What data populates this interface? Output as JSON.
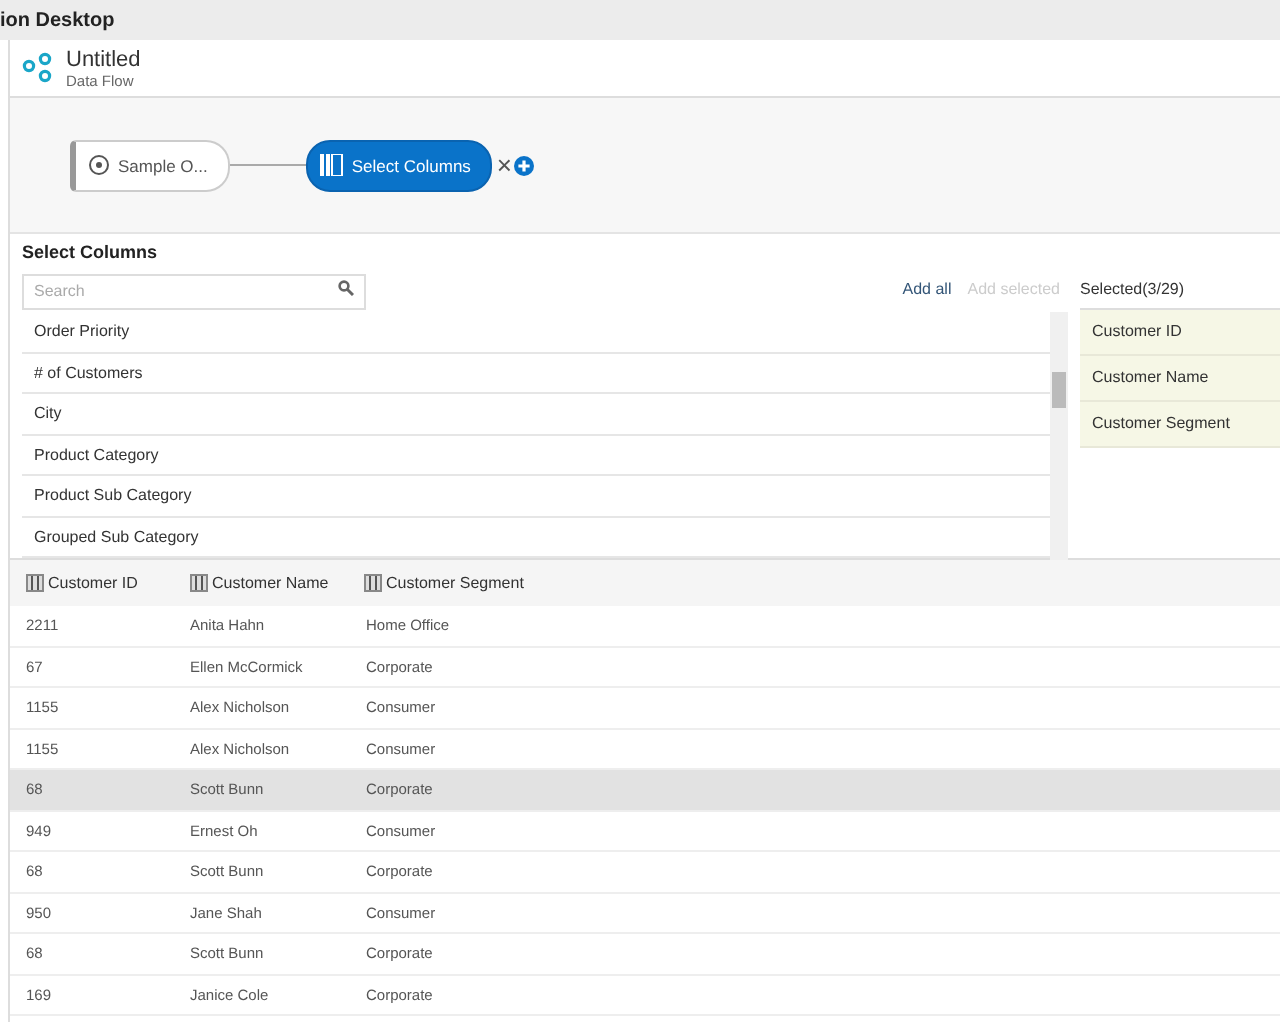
{
  "window": {
    "title": "ion Desktop"
  },
  "header": {
    "title": "Untitled",
    "subtitle": "Data Flow"
  },
  "flow": {
    "nodes": [
      {
        "kind": "source",
        "label": "Sample O...",
        "selected": false
      },
      {
        "kind": "step",
        "label": "Select Columns",
        "selected": true
      }
    ],
    "remove": "×"
  },
  "panel": {
    "title": "Select Columns",
    "search": {
      "placeholder": "Search"
    },
    "add_all": "Add all",
    "add_selected": {
      "label": "Add selected",
      "disabled": true
    },
    "selected_title": "Selected(3/29)",
    "available": [
      "Order Priority",
      "# of Customers",
      "City",
      "Product Category",
      "Product Sub Category",
      "Grouped Sub Category"
    ],
    "selected": [
      "Customer ID",
      "Customer Name",
      "Customer Segment"
    ]
  },
  "table": {
    "columns": [
      "Customer ID",
      "Customer Name",
      "Customer Segment"
    ],
    "rows": [
      {
        "cells": [
          "2211",
          "Anita Hahn",
          "Home Office"
        ],
        "selected": false
      },
      {
        "cells": [
          "67",
          "Ellen McCormick",
          "Corporate"
        ],
        "selected": false
      },
      {
        "cells": [
          "1155",
          "Alex Nicholson",
          "Consumer"
        ],
        "selected": false
      },
      {
        "cells": [
          "1155",
          "Alex Nicholson",
          "Consumer"
        ],
        "selected": false
      },
      {
        "cells": [
          "68",
          "Scott Bunn",
          "Corporate"
        ],
        "selected": true
      },
      {
        "cells": [
          "949",
          "Ernest Oh",
          "Consumer"
        ],
        "selected": false
      },
      {
        "cells": [
          "68",
          "Scott Bunn",
          "Corporate"
        ],
        "selected": false
      },
      {
        "cells": [
          "950",
          "Jane Shah",
          "Consumer"
        ],
        "selected": false
      },
      {
        "cells": [
          "68",
          "Scott Bunn",
          "Corporate"
        ],
        "selected": false
      },
      {
        "cells": [
          "169",
          "Janice Cole",
          "Corporate"
        ],
        "selected": false
      }
    ]
  }
}
